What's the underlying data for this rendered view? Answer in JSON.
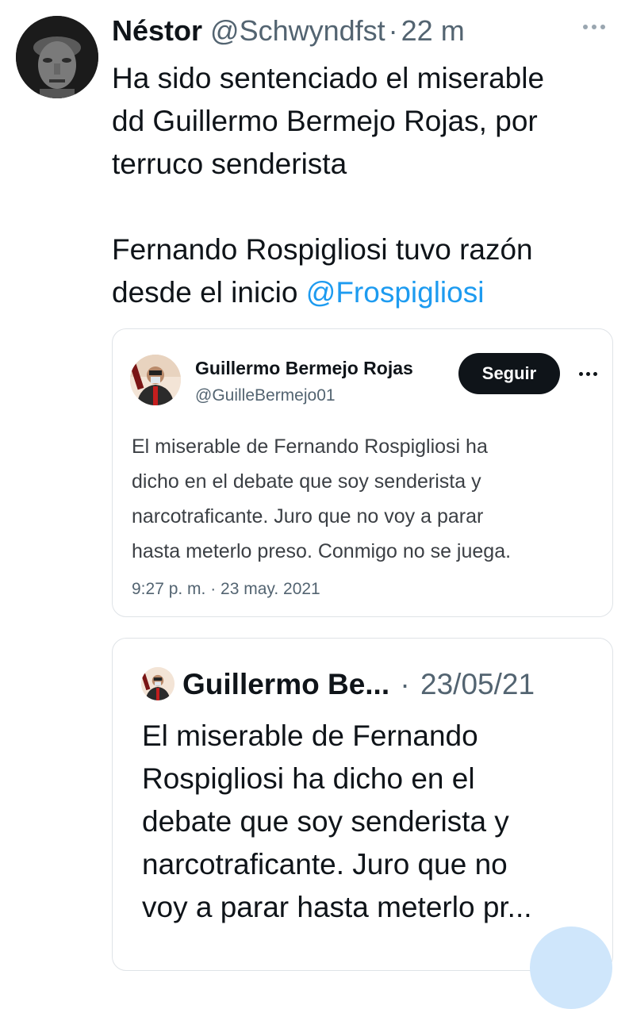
{
  "tweet": {
    "author_name": "Néstor",
    "author_handle": "@Schwyndfst",
    "separator": "·",
    "time": "22 m",
    "text_line1": "Ha sido sentenciado el miserable",
    "text_line2": "dd Guillermo Bermejo Rojas, por",
    "text_line3": "terruco senderista",
    "text_line4": "Fernando Rospigliosi tuvo razón",
    "text_line5": "desde el inicio",
    "mention": "@Frospigliosi"
  },
  "quoted_card": {
    "author_name": "Guillermo Bermejo Rojas",
    "author_handle": "@GuilleBermejo01",
    "follow_label": "Seguir",
    "text_line1": "El miserable de Fernando Rospigliosi ha",
    "text_line2": "dicho en el debate que soy senderista y",
    "text_line3": "narcotraficante. Juro que no voy a parar",
    "text_line4": "hasta meterlo preso. Conmigo no se juega.",
    "timestamp": "9:27 p. m. · 23 may. 2021"
  },
  "quoted_tweet": {
    "author_name": "Guillermo Be...",
    "separator": "·",
    "date": "23/05/21",
    "text_line1": "El miserable de Fernando",
    "text_line2": "Rospigliosi ha dicho en el",
    "text_line3": "debate que soy senderista y",
    "text_line4": "narcotraficante. Juro que no",
    "text_line5": "voy a parar hasta meterlo pr..."
  },
  "colors": {
    "text": "#0f1419",
    "secondary": "#536471",
    "mention": "#1d9bf0",
    "follow_button": "#0f1419",
    "border": "#dfe3e7"
  },
  "icons": {
    "more": "more-horizontal-icon"
  }
}
